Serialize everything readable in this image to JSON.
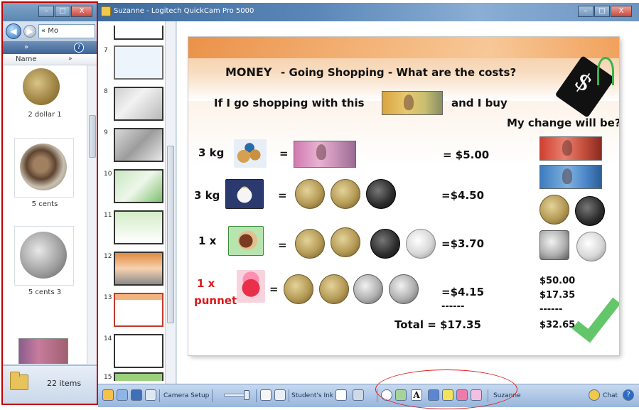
{
  "explorer": {
    "address": "« Mo",
    "column_header": "Name",
    "column_more": "»",
    "files": [
      {
        "label": "2 dollar 1"
      },
      {
        "label": "5 cents"
      },
      {
        "label": "5 cents 3"
      },
      {
        "label": ""
      }
    ],
    "status": {
      "count": "22 items"
    },
    "window_buttons": {
      "minimize": "–",
      "maximize": "□",
      "close": "X"
    }
  },
  "app": {
    "title": "Suzanne - Logitech QuickCam Pro 5000",
    "window_buttons": {
      "minimize": "–",
      "maximize": "□",
      "close": "X"
    },
    "slide_numbers": [
      "7",
      "8",
      "9",
      "10",
      "11",
      "12",
      "13",
      "14",
      "15"
    ],
    "toolbar": {
      "camera_setup": "Camera Setup",
      "students_ink": "Student's Ink",
      "text_tool": "A",
      "user": "Suzanne",
      "chat": "Chat",
      "help": "?"
    }
  },
  "slide": {
    "title_money": "MONEY",
    "title_sub": "- Going Shopping  - What are the costs?",
    "intro_a": "If I go shopping with this",
    "intro_b": "and I buy",
    "change_prompt": "My change will be?",
    "dollar_sign": "$",
    "rows": [
      {
        "qty": "3 kg",
        "equals": "=",
        "price": "= $5.00"
      },
      {
        "qty": "3 kg",
        "equals": "=",
        "price": "=$4.50"
      },
      {
        "qty": "1 x",
        "equals": "=",
        "price": "=$3.70"
      },
      {
        "qty": "1 x",
        "qty2": "punnet",
        "equals": "=",
        "price": "=$4.15"
      }
    ],
    "total_dashes": "------",
    "total": "Total = $17.35",
    "calc": {
      "line1": "$50.00",
      "line2": "$17.35",
      "dashes": "------",
      "result": "$32.65"
    }
  }
}
